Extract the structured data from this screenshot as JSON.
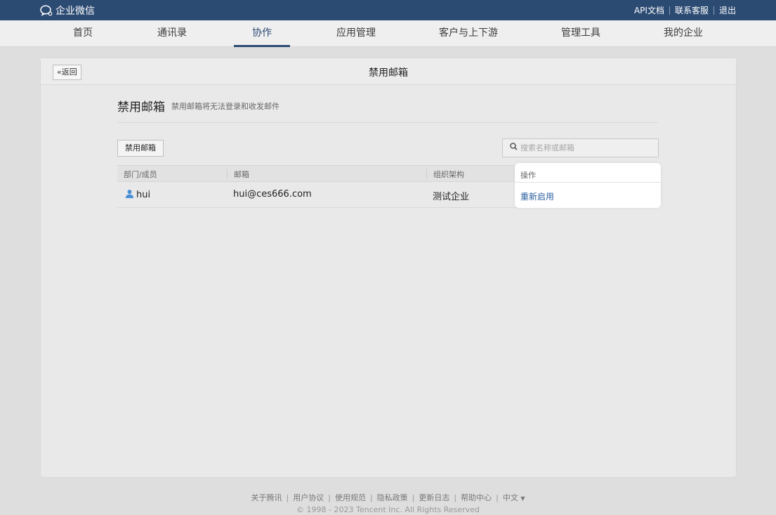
{
  "topbar": {
    "logo_text": "企业微信",
    "links": [
      "API文档",
      "联系客服",
      "退出"
    ]
  },
  "nav": {
    "items": [
      "首页",
      "通讯录",
      "协作",
      "应用管理",
      "客户与上下游",
      "管理工具",
      "我的企业"
    ],
    "active": "协作"
  },
  "panel": {
    "back_label": "«返回",
    "title": "禁用邮箱"
  },
  "section": {
    "title": "禁用邮箱",
    "desc": "禁用邮箱将无法登录和收发邮件"
  },
  "toolbar": {
    "action_label": "禁用邮箱",
    "search_placeholder": "搜索名称或邮箱"
  },
  "table": {
    "columns": [
      "部门/成员",
      "邮箱",
      "组织架构",
      "操作"
    ],
    "rows": [
      {
        "member": "hui",
        "email": "hui@ces666.com",
        "org": "测试企业",
        "action": "重新启用"
      }
    ]
  },
  "footer": {
    "links": [
      "关于腾讯",
      "用户协议",
      "使用规范",
      "隐私政策",
      "更新日志",
      "帮助中心"
    ],
    "language": "中文",
    "copyright": "© 1998 - 2023 Tencent Inc. All Rights Reserved"
  },
  "colors": {
    "brand": "#2c4b73",
    "link": "#2c5f9e",
    "background": "#dedede"
  }
}
